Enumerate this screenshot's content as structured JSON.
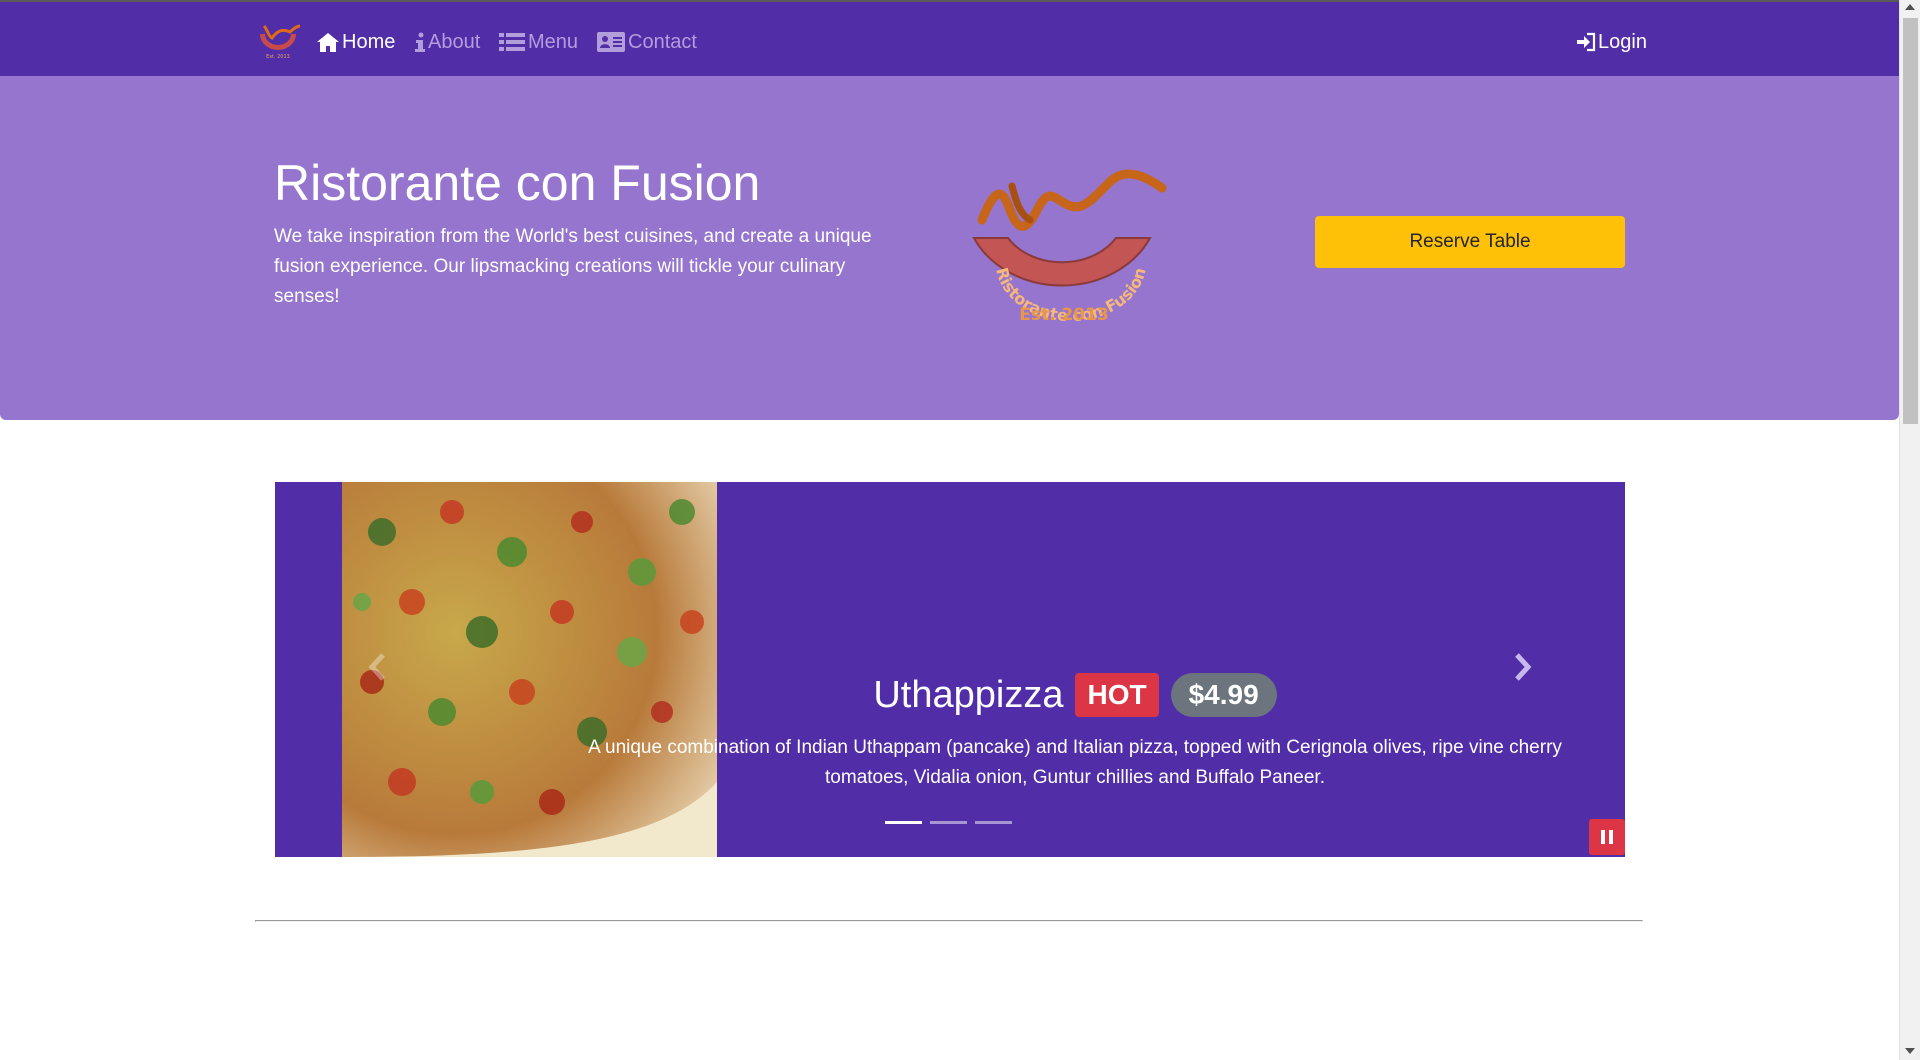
{
  "nav": {
    "items": [
      {
        "label": "Home",
        "icon": "home-icon",
        "active": true
      },
      {
        "label": "About",
        "icon": "info-icon",
        "active": false
      },
      {
        "label": "Menu",
        "icon": "list-icon",
        "active": false
      },
      {
        "label": "Contact",
        "icon": "address-card-icon",
        "active": false
      }
    ],
    "login_label": "Login"
  },
  "hero": {
    "title": "Ristorante con Fusion",
    "text": "We take inspiration from the World's best cuisines, and create a unique fusion experience. Our lipsmacking creations will tickle your culinary senses!",
    "logo_text": "Ristorante con Fusion",
    "logo_est": "Est. 2013",
    "reserve_label": "Reserve Table"
  },
  "carousel": {
    "name": "Uthappizza",
    "label": "HOT",
    "price": "$4.99",
    "description": "A unique combination of Indian Uthappam (pancake) and Italian pizza, topped with Cerignola olives, ripe vine cherry tomatoes, Vidalia onion, Guntur chillies and Buffalo Paneer.",
    "slides": 3,
    "active_slide": 1
  },
  "colors": {
    "primary": "#512da8",
    "light": "#9575cd",
    "nav_inactive": "#b39ddb",
    "warning": "#ffc107",
    "danger": "#dc3545",
    "secondary": "#6c757d"
  }
}
